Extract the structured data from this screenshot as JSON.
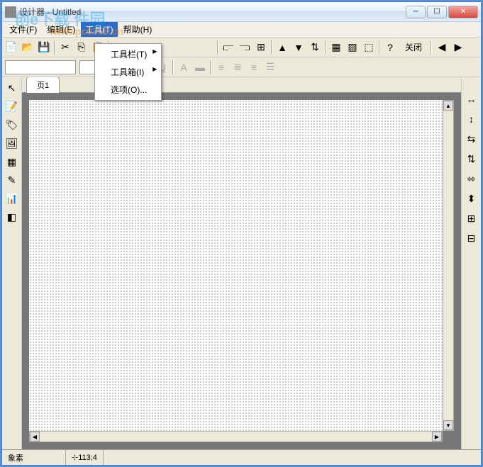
{
  "titlebar": {
    "title": "设计器 - Untitled"
  },
  "menubar": {
    "file": "文件(F)",
    "edit": "编辑(E)",
    "tools": "工具(T)",
    "help": "帮助(H)"
  },
  "tools_menu": {
    "toolbar": "工具栏(T)",
    "toolbox": "工具箱(I)",
    "options": "选项(O)..."
  },
  "toolbar": {
    "close_label": "关闭"
  },
  "tabs": {
    "page1": "页1"
  },
  "statusbar": {
    "elements": "象素",
    "coords": "113;4"
  },
  "watermark": {
    "main": "创e下载 件园",
    "sub": "www.pc0359.cn"
  },
  "toolbox_left": [
    "pointer",
    "text",
    "label",
    "image",
    "table",
    "draw",
    "chart",
    "shape"
  ],
  "toolbox_right": [
    "align-h",
    "align-v",
    "dist-h",
    "dist-v",
    "size-w",
    "size-h",
    "group",
    "ungroup"
  ]
}
